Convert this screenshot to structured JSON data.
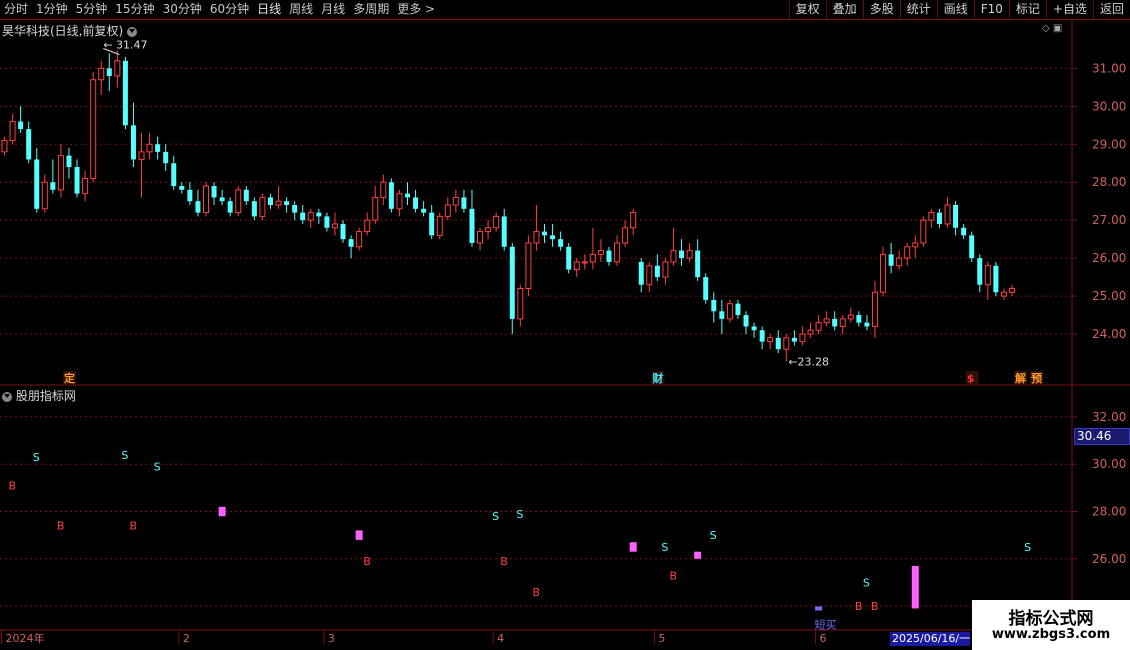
{
  "toolbar": {
    "periods": [
      "分时",
      "1分钟",
      "5分钟",
      "15分钟",
      "30分钟",
      "60分钟",
      "日线",
      "周线",
      "月线",
      "多周期",
      "更多 >"
    ],
    "active_period": "日线",
    "tools": [
      "复权",
      "叠加",
      "多股",
      "统计",
      "画线",
      "F10",
      "标记",
      "+自选",
      "返回"
    ]
  },
  "stock": {
    "title": "昊华科技(日线,前复权)"
  },
  "indicator": {
    "title": "股朋指标网",
    "current_value": "30.46"
  },
  "annotations": {
    "high_label": "31.47",
    "low_label": "23.28"
  },
  "event_markers": [
    {
      "label": "定",
      "color": "#ff9a2a"
    },
    {
      "label": "财",
      "color": "#46e4ff"
    },
    {
      "label": "$",
      "color": "#ff3030"
    },
    {
      "label": "解",
      "color": "#ff9a2a"
    },
    {
      "label": "预",
      "color": "#ff9a2a"
    }
  ],
  "signal_labels": {
    "buy": "B",
    "sell": "S",
    "short_buy": "短买"
  },
  "x_axis": {
    "labels": [
      "2024年",
      "2",
      "3",
      "4",
      "5",
      "6"
    ]
  },
  "date_box": "2025/06/16/一",
  "watermark": {
    "title": "指标公式网",
    "url": "www.zbgs3.com"
  },
  "colors": {
    "up": "#ff4040",
    "down": "#54ffff",
    "grid": "#7a1010",
    "signal_bar": "#ff60ff",
    "short_bar": "#7070ff"
  },
  "chart_data": [
    {
      "type": "candlestick",
      "title": "昊华科技(日线,前复权)",
      "y_ticks": [
        24.0,
        25.0,
        26.0,
        27.0,
        28.0,
        29.0,
        30.0,
        31.0
      ],
      "ylim": [
        23.0,
        31.8
      ],
      "x_period_labels": [
        "2024年",
        "2",
        "3",
        "4",
        "5",
        "6"
      ],
      "candles": [
        [
          28.8,
          29.2,
          28.7,
          29.1
        ],
        [
          29.1,
          29.8,
          29.0,
          29.6
        ],
        [
          29.6,
          30.0,
          29.3,
          29.4
        ],
        [
          29.4,
          29.6,
          28.5,
          28.6
        ],
        [
          28.6,
          28.9,
          27.2,
          27.3
        ],
        [
          27.3,
          28.2,
          27.2,
          28.0
        ],
        [
          28.0,
          28.6,
          27.7,
          27.8
        ],
        [
          27.8,
          29.0,
          27.6,
          28.7
        ],
        [
          28.7,
          28.9,
          28.1,
          28.4
        ],
        [
          28.4,
          28.6,
          27.6,
          27.7
        ],
        [
          27.7,
          28.3,
          27.5,
          28.1
        ],
        [
          28.1,
          30.9,
          28.0,
          30.7
        ],
        [
          30.7,
          31.2,
          30.3,
          31.0
        ],
        [
          31.0,
          31.4,
          30.4,
          30.8
        ],
        [
          30.8,
          31.47,
          30.5,
          31.2
        ],
        [
          31.2,
          31.3,
          29.4,
          29.5
        ],
        [
          29.5,
          30.1,
          28.4,
          28.6
        ],
        [
          28.6,
          29.3,
          27.6,
          28.8
        ],
        [
          28.8,
          29.3,
          28.6,
          29.0
        ],
        [
          29.0,
          29.2,
          28.6,
          28.8
        ],
        [
          28.8,
          29.0,
          28.3,
          28.5
        ],
        [
          28.5,
          28.7,
          27.8,
          27.9
        ],
        [
          27.9,
          28.0,
          27.7,
          27.8
        ],
        [
          27.8,
          28.0,
          27.4,
          27.5
        ],
        [
          27.5,
          27.8,
          27.1,
          27.2
        ],
        [
          27.2,
          28.0,
          27.1,
          27.9
        ],
        [
          27.9,
          28.0,
          27.4,
          27.6
        ],
        [
          27.6,
          27.8,
          27.4,
          27.5
        ],
        [
          27.5,
          27.6,
          27.1,
          27.2
        ],
        [
          27.2,
          27.9,
          27.1,
          27.8
        ],
        [
          27.8,
          27.9,
          27.4,
          27.5
        ],
        [
          27.5,
          27.6,
          27.0,
          27.1
        ],
        [
          27.1,
          27.7,
          27.0,
          27.6
        ],
        [
          27.6,
          27.7,
          27.3,
          27.4
        ],
        [
          27.4,
          27.9,
          27.3,
          27.5
        ],
        [
          27.5,
          27.6,
          27.2,
          27.4
        ],
        [
          27.4,
          27.5,
          27.0,
          27.2
        ],
        [
          27.2,
          27.4,
          26.9,
          27.0
        ],
        [
          27.0,
          27.3,
          26.8,
          27.2
        ],
        [
          27.2,
          27.3,
          26.9,
          27.1
        ],
        [
          27.1,
          27.2,
          26.7,
          26.8
        ],
        [
          26.8,
          27.2,
          26.6,
          26.9
        ],
        [
          26.9,
          27.0,
          26.4,
          26.5
        ],
        [
          26.5,
          26.6,
          26.0,
          26.3
        ],
        [
          26.3,
          26.8,
          26.2,
          26.7
        ],
        [
          26.7,
          27.2,
          26.6,
          27.0
        ],
        [
          27.0,
          27.9,
          26.9,
          27.6
        ],
        [
          27.6,
          28.2,
          27.4,
          28.0
        ],
        [
          28.0,
          28.1,
          27.2,
          27.3
        ],
        [
          27.3,
          27.8,
          27.1,
          27.7
        ],
        [
          27.7,
          28.0,
          27.4,
          27.6
        ],
        [
          27.6,
          27.8,
          27.2,
          27.3
        ],
        [
          27.3,
          27.5,
          27.1,
          27.2
        ],
        [
          27.2,
          27.4,
          26.5,
          26.6
        ],
        [
          26.6,
          27.2,
          26.5,
          27.1
        ],
        [
          27.1,
          27.6,
          27.0,
          27.4
        ],
        [
          27.4,
          27.8,
          27.2,
          27.6
        ],
        [
          27.6,
          27.8,
          27.2,
          27.3
        ],
        [
          27.3,
          27.8,
          26.3,
          26.4
        ],
        [
          26.4,
          26.8,
          26.2,
          26.7
        ],
        [
          26.7,
          27.0,
          26.5,
          26.8
        ],
        [
          26.8,
          27.2,
          26.7,
          27.1
        ],
        [
          27.1,
          27.3,
          26.2,
          26.3
        ],
        [
          26.3,
          26.4,
          24.0,
          24.4
        ],
        [
          24.4,
          25.3,
          24.2,
          25.2
        ],
        [
          25.2,
          26.6,
          25.0,
          26.4
        ],
        [
          26.4,
          27.4,
          26.2,
          26.7
        ],
        [
          26.7,
          26.9,
          26.4,
          26.6
        ],
        [
          26.6,
          26.9,
          26.3,
          26.5
        ],
        [
          26.5,
          26.7,
          26.2,
          26.3
        ],
        [
          26.3,
          26.4,
          25.6,
          25.7
        ],
        [
          25.7,
          26.0,
          25.5,
          25.9
        ],
        [
          25.9,
          26.1,
          25.7,
          25.9
        ],
        [
          25.9,
          26.8,
          25.7,
          26.1
        ],
        [
          26.1,
          26.5,
          25.9,
          26.2
        ],
        [
          26.2,
          26.3,
          25.8,
          25.9
        ],
        [
          25.9,
          26.6,
          25.8,
          26.4
        ],
        [
          26.4,
          27.0,
          26.3,
          26.8
        ],
        [
          26.8,
          27.3,
          26.6,
          27.2
        ],
        [
          25.9,
          26.0,
          25.1,
          25.3
        ],
        [
          25.3,
          25.9,
          25.1,
          25.8
        ],
        [
          25.8,
          26.1,
          25.4,
          25.5
        ],
        [
          25.5,
          26.0,
          25.3,
          25.9
        ],
        [
          25.9,
          26.8,
          25.8,
          26.2
        ],
        [
          26.2,
          26.5,
          25.8,
          26.0
        ],
        [
          26.0,
          26.4,
          25.9,
          26.2
        ],
        [
          26.2,
          26.5,
          25.4,
          25.5
        ],
        [
          25.5,
          25.6,
          24.8,
          24.9
        ],
        [
          24.9,
          25.1,
          24.3,
          24.6
        ],
        [
          24.6,
          24.9,
          24.0,
          24.4
        ],
        [
          24.4,
          24.9,
          24.3,
          24.8
        ],
        [
          24.8,
          24.9,
          24.4,
          24.5
        ],
        [
          24.5,
          24.6,
          24.0,
          24.2
        ],
        [
          24.2,
          24.3,
          23.9,
          24.1
        ],
        [
          24.1,
          24.2,
          23.6,
          23.8
        ],
        [
          23.8,
          24.0,
          23.6,
          23.9
        ],
        [
          23.9,
          24.1,
          23.5,
          23.6
        ],
        [
          23.6,
          24.0,
          23.28,
          23.9
        ],
        [
          23.9,
          24.1,
          23.7,
          23.8
        ],
        [
          23.8,
          24.2,
          23.7,
          24.0
        ],
        [
          24.0,
          24.3,
          23.9,
          24.1
        ],
        [
          24.1,
          24.5,
          24.0,
          24.3
        ],
        [
          24.3,
          24.6,
          24.2,
          24.4
        ],
        [
          24.4,
          24.6,
          24.1,
          24.2
        ],
        [
          24.2,
          24.5,
          24.0,
          24.4
        ],
        [
          24.4,
          24.7,
          24.3,
          24.5
        ],
        [
          24.5,
          24.6,
          24.2,
          24.3
        ],
        [
          24.3,
          24.5,
          24.1,
          24.2
        ],
        [
          24.2,
          25.4,
          23.9,
          25.1
        ],
        [
          25.1,
          26.3,
          25.0,
          26.1
        ],
        [
          26.1,
          26.4,
          25.6,
          25.8
        ],
        [
          25.8,
          26.2,
          25.7,
          26.0
        ],
        [
          26.0,
          26.4,
          25.8,
          26.3
        ],
        [
          26.3,
          26.6,
          26.0,
          26.4
        ],
        [
          26.4,
          27.1,
          26.3,
          27.0
        ],
        [
          27.0,
          27.3,
          26.8,
          27.2
        ],
        [
          27.2,
          27.3,
          26.8,
          26.9
        ],
        [
          26.9,
          27.6,
          26.8,
          27.4
        ],
        [
          27.4,
          27.5,
          26.6,
          26.8
        ],
        [
          26.8,
          26.9,
          26.5,
          26.6
        ],
        [
          26.6,
          26.7,
          25.9,
          26.0
        ],
        [
          26.0,
          26.1,
          25.1,
          25.3
        ],
        [
          25.3,
          25.9,
          24.9,
          25.8
        ],
        [
          25.8,
          25.9,
          25.0,
          25.1
        ],
        [
          25.0,
          25.2,
          24.9,
          25.1
        ],
        [
          25.1,
          25.3,
          25.0,
          25.2
        ]
      ]
    },
    {
      "type": "signals",
      "title": "股朋指标网",
      "y_ticks": [
        24.0,
        26.0,
        28.0,
        30.0,
        32.0
      ],
      "ylim": [
        23.2,
        32.8
      ],
      "current_value": 30.46,
      "sell_signals": [
        [
          4,
          30.3
        ],
        [
          15,
          30.4
        ],
        [
          19,
          29.9
        ],
        [
          61,
          27.8
        ],
        [
          64,
          27.9
        ],
        [
          82,
          26.5
        ],
        [
          88,
          27.0
        ],
        [
          107,
          25.0
        ],
        [
          127,
          26.5
        ]
      ],
      "buy_signals": [
        [
          1,
          29.1
        ],
        [
          7,
          27.4
        ],
        [
          16,
          27.4
        ],
        [
          45,
          25.9
        ],
        [
          62,
          25.9
        ],
        [
          66,
          24.6
        ],
        [
          83,
          25.3
        ],
        [
          106,
          24.0
        ],
        [
          108,
          24.0
        ]
      ],
      "signal_bars": [
        [
          27,
          28.2,
          27.8
        ],
        [
          44,
          27.2,
          26.8
        ],
        [
          78,
          26.7,
          26.3
        ],
        [
          86,
          26.3,
          26.0
        ],
        [
          113,
          25.7,
          23.9
        ]
      ],
      "short_buy": [
        [
          101,
          23.9
        ]
      ]
    }
  ]
}
